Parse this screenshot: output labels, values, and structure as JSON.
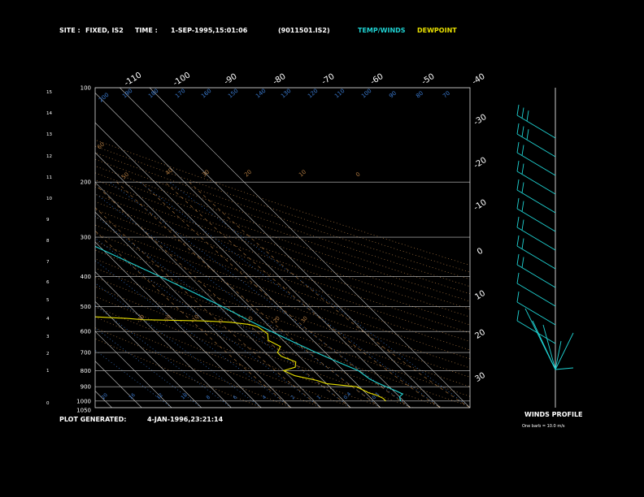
{
  "header": {
    "site_label": "SITE :",
    "site_value": "FIXED, IS2",
    "time_label": "TIME :",
    "time_value": "1-SEP-1995,15:01:06",
    "file_id": "(9011501.IS2)",
    "temp_winds": "TEMP/WINDS",
    "dewpoint": "DEWPOINT"
  },
  "footer": {
    "generated_label": "PLOT GENERATED:",
    "generated_value": "4-JAN-1996,23:21:14"
  },
  "winds": {
    "title": "WINDS PROFILE",
    "note": "One barb = 10.0 m/s"
  },
  "colors": {
    "background": "#000000",
    "text": "#ffffff",
    "temperature": "#1fd3d3",
    "dewpoint": "#e8e000",
    "grid": "#c8c8c8",
    "dry_adiabat": "#b07a40",
    "moist_adiabat": "#b07a40",
    "mixing_ratio": "#3a7ad0",
    "winds": "#1fd3d3"
  },
  "chart_data": {
    "type": "line",
    "skew_t": true,
    "pressure_axis": {
      "ticks": [
        100,
        200,
        300,
        400,
        500,
        600,
        700,
        800,
        900,
        1000,
        1050
      ],
      "labels": [
        "100",
        "200",
        "300",
        "400",
        "500",
        "600",
        "700",
        "800",
        "900",
        "1000",
        "1050"
      ]
    },
    "height_axis": {
      "ticks": [
        15,
        14,
        13,
        12,
        11,
        10,
        9,
        8,
        7,
        6,
        5,
        4,
        3,
        2,
        1,
        0
      ],
      "labels": [
        "15",
        "14",
        "13",
        "12",
        "11",
        "10",
        "9",
        "8",
        "7",
        "6",
        "5",
        "4",
        "3",
        "2",
        "1",
        "0"
      ]
    },
    "isotherm_labels_top": [
      "-110",
      "-100",
      "-90",
      "-80",
      "-70",
      "-60",
      "-50",
      "-40"
    ],
    "isotherm_labels_right": [
      "-30",
      "-20",
      "-10",
      "0",
      "10",
      "20",
      "30"
    ],
    "series": [
      {
        "key": "temperature",
        "points": [
          [
            1000,
            19
          ],
          [
            970,
            20
          ],
          [
            950,
            22
          ],
          [
            930,
            21
          ],
          [
            900,
            19
          ],
          [
            870,
            17
          ],
          [
            850,
            16
          ],
          [
            800,
            15
          ],
          [
            750,
            11
          ],
          [
            700,
            7
          ],
          [
            650,
            3
          ],
          [
            600,
            -1
          ],
          [
            550,
            -5
          ],
          [
            500,
            -9
          ],
          [
            450,
            -14
          ],
          [
            400,
            -20
          ],
          [
            350,
            -27
          ],
          [
            300,
            -35
          ],
          [
            250,
            -46
          ],
          [
            200,
            -57
          ],
          [
            180,
            -59
          ],
          [
            160,
            -60
          ],
          [
            140,
            -60
          ],
          [
            120,
            -58
          ],
          [
            110,
            -57
          ],
          [
            100,
            -57
          ]
        ]
      },
      {
        "key": "dewpoint",
        "points": [
          [
            1000,
            14
          ],
          [
            980,
            14
          ],
          [
            960,
            13
          ],
          [
            940,
            11
          ],
          [
            900,
            9
          ],
          [
            880,
            0
          ],
          [
            860,
            -2
          ],
          [
            830,
            -8
          ],
          [
            800,
            -10
          ],
          [
            780,
            -5
          ],
          [
            750,
            -3
          ],
          [
            720,
            -6
          ],
          [
            700,
            -6
          ],
          [
            670,
            -3
          ],
          [
            640,
            -5
          ],
          [
            610,
            -3
          ],
          [
            580,
            -4
          ],
          [
            570,
            -6
          ],
          [
            560,
            -12
          ],
          [
            555,
            -20
          ],
          [
            550,
            -40
          ],
          [
            545,
            -45
          ],
          [
            530,
            -70
          ],
          [
            515,
            -95
          ],
          [
            505,
            -85
          ],
          [
            490,
            -110
          ],
          [
            470,
            -105
          ],
          [
            450,
            -110
          ],
          [
            430,
            -95
          ],
          [
            410,
            -105
          ],
          [
            400,
            -110
          ],
          [
            380,
            -95
          ],
          [
            370,
            -86
          ],
          [
            360,
            -93
          ],
          [
            340,
            -92
          ],
          [
            320,
            -93
          ],
          [
            300,
            -88
          ],
          [
            280,
            -86
          ],
          [
            250,
            -82
          ],
          [
            230,
            -80
          ],
          [
            210,
            -80
          ],
          [
            190,
            -84
          ],
          [
            170,
            -90
          ],
          [
            160,
            -94
          ]
        ]
      }
    ],
    "mixing_ratio_labels": [
      "20",
      "16",
      "12",
      "10",
      "8",
      "6",
      "4",
      "2",
      "1",
      "0.4",
      "0.1"
    ],
    "dry_adiabat_labels": [
      "200",
      "190",
      "180",
      "170",
      "160",
      "150",
      "140",
      "130",
      "120",
      "110",
      "100",
      "90",
      "80",
      "70",
      "60",
      "50",
      "40",
      "30",
      "20",
      "10",
      "0"
    ],
    "moist_adiabat_labels": [
      "-30",
      "-20",
      "-10",
      "0",
      "10",
      "20",
      "30"
    ],
    "wind_profile": {
      "units": "m/s",
      "levels": [
        {
          "barbs": 3,
          "pennant": false
        },
        {
          "barbs": 3,
          "pennant": false
        },
        {
          "barbs": 2,
          "pennant": false
        },
        {
          "barbs": 2,
          "pennant": false
        },
        {
          "barbs": 2,
          "pennant": false
        },
        {
          "barbs": 2,
          "pennant": false
        },
        {
          "barbs": 2,
          "pennant": false
        },
        {
          "barbs": 2,
          "pennant": false
        },
        {
          "barbs": 2,
          "pennant": false
        },
        {
          "barbs": 1,
          "pennant": false
        },
        {
          "barbs": 1,
          "pennant": false
        },
        {
          "barbs": 1,
          "pennant": false
        }
      ]
    }
  }
}
